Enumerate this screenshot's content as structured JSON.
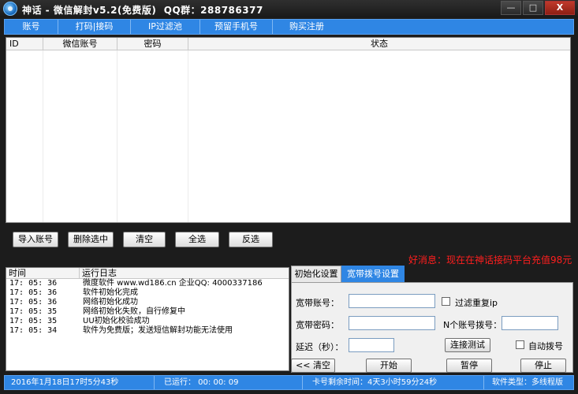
{
  "window": {
    "title": "神话 - 微信解封v5.2(免费版)  QQ群：288786377",
    "minimize_glyph": "—",
    "maximize_glyph": "□",
    "close_glyph": "X"
  },
  "menu": {
    "items": [
      "账号",
      "打码|接码",
      "IP过滤池",
      "预留手机号",
      "购买注册"
    ]
  },
  "grid": {
    "columns": [
      "ID",
      "微信账号",
      "密码",
      "状态"
    ]
  },
  "actions": {
    "import": "导入账号",
    "delete_selected": "删除选中",
    "clear": "清空",
    "select_all": "全选",
    "invert": "反选"
  },
  "promo": {
    "text": "好消息：现在在神话接码平台充值98元"
  },
  "log": {
    "columns": [
      "时间",
      "运行日志"
    ],
    "rows": [
      {
        "time": "17: 05: 36",
        "msg": "微度软件 www.wd186.cn  企业QQ: 4000337186"
      },
      {
        "time": "17: 05: 36",
        "msg": "软件初始化完成"
      },
      {
        "time": "17: 05: 36",
        "msg": "网络初始化成功"
      },
      {
        "time": "17: 05: 35",
        "msg": "网络初始化失败，自行修复中"
      },
      {
        "time": "17: 05: 35",
        "msg": "UU初始化校验成功"
      },
      {
        "time": "17: 05: 34",
        "msg": "软件为免费版；发送短信解封功能无法使用"
      }
    ]
  },
  "settings": {
    "tabs": [
      "初始化设置",
      "宽带拨号设置"
    ],
    "broadband_account_label": "宽带账号：",
    "broadband_account_value": "",
    "broadband_password_label": "宽带密码：",
    "broadband_password_value": "",
    "delay_label": "延迟（秒）：",
    "delay_value": "",
    "filter_duplicate_ip_label": "过滤重复ip",
    "n_accounts_dial_label": "N个账号拨号：",
    "n_accounts_dial_value": "",
    "test_connection": "连接测试",
    "auto_dial_label": "自动拨号"
  },
  "controls": {
    "clear_log": "<< 清空",
    "start": "开始",
    "pause": "暂停",
    "stop": "停止"
  },
  "status": {
    "datetime": "2016年1月18日17时5分43秒",
    "running": "已运行： 00: 00: 09",
    "card_remaining": "卡号剩余时间：4天3小时59分24秒",
    "software_type": "软件类型：多线程版"
  },
  "colors": {
    "accent": "#2f86e4",
    "promo": "#ff1e1e"
  }
}
